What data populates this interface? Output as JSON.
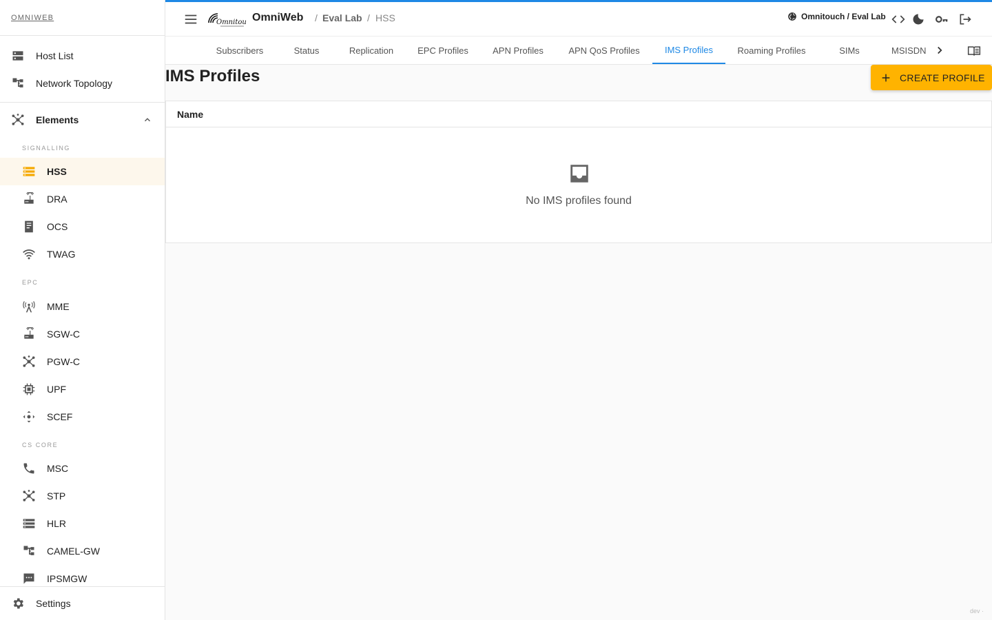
{
  "sidebar": {
    "brand": "OMNIWEB",
    "top_items": [
      {
        "label": "Host List",
        "icon": "dns-icon"
      },
      {
        "label": "Network Topology",
        "icon": "account-tree-icon"
      }
    ],
    "elements_group": {
      "label": "Elements",
      "icon": "hub-icon",
      "expanded": true
    },
    "sections": [
      {
        "header": "SIGNALLING",
        "items": [
          {
            "label": "HSS",
            "icon": "storage-icon",
            "active": true
          },
          {
            "label": "DRA",
            "icon": "router-icon"
          },
          {
            "label": "OCS",
            "icon": "receipt-icon"
          },
          {
            "label": "TWAG",
            "icon": "wifi-icon"
          }
        ]
      },
      {
        "header": "EPC",
        "items": [
          {
            "label": "MME",
            "icon": "cell-tower-icon"
          },
          {
            "label": "SGW-C",
            "icon": "router-icon"
          },
          {
            "label": "PGW-C",
            "icon": "hub-icon"
          },
          {
            "label": "UPF",
            "icon": "memory-icon"
          },
          {
            "label": "SCEF",
            "icon": "control-camera-icon"
          }
        ]
      },
      {
        "header": "CS CORE",
        "items": [
          {
            "label": "MSC",
            "icon": "phone-icon"
          },
          {
            "label": "STP",
            "icon": "hub-icon"
          },
          {
            "label": "HLR",
            "icon": "list-storage-icon"
          },
          {
            "label": "CAMEL-GW",
            "icon": "account-tree-icon"
          },
          {
            "label": "IPSMGW",
            "icon": "sms-icon"
          }
        ]
      }
    ],
    "settings": {
      "label": "Settings",
      "icon": "gear-icon"
    }
  },
  "topbar": {
    "app_name": "OmniWeb",
    "logo_text": "Omnitouch",
    "breadcrumb": [
      "/",
      "Eval Lab",
      "/",
      "HSS"
    ],
    "tenant": "Omnitouch / Eval Lab",
    "accent_color": "#1e88e5"
  },
  "tabs": {
    "items": [
      "Subscribers",
      "Status",
      "Replication",
      "EPC Profiles",
      "APN Profiles",
      "APN QoS Profiles",
      "IMS Profiles",
      "Roaming Profiles",
      "SIMs"
    ],
    "overflow_item": "MSISDN",
    "active": "IMS Profiles"
  },
  "content": {
    "title": "IMS Profiles",
    "create_label": "CREATE PROFILE",
    "create_color": "#ffb300",
    "table_header": "Name",
    "empty_message": "No IMS profiles found"
  },
  "footer": {
    "env": "dev ·"
  }
}
